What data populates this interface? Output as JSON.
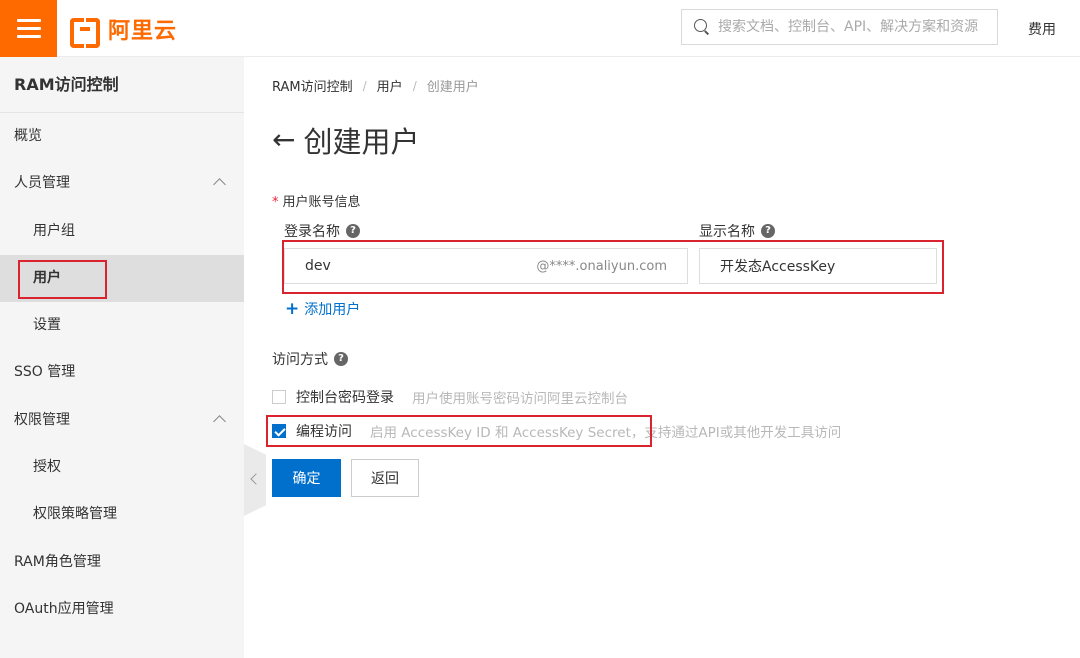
{
  "header": {
    "logo_text": "阿里云",
    "search_placeholder": "搜索文档、控制台、API、解决方案和资源",
    "fee_label": "费用",
    "brand_color": "#ff6a00"
  },
  "sidebar": {
    "title": "RAM访问控制",
    "items": [
      {
        "label": "概览"
      },
      {
        "label": "人员管理"
      },
      {
        "label": "用户组"
      },
      {
        "label": "用户"
      },
      {
        "label": "设置"
      },
      {
        "label": "SSO 管理"
      },
      {
        "label": "权限管理"
      },
      {
        "label": "授权"
      },
      {
        "label": "权限策略管理"
      },
      {
        "label": "RAM角色管理"
      },
      {
        "label": "OAuth应用管理"
      }
    ]
  },
  "breadcrumb": [
    "RAM访问控制",
    "用户",
    "创建用户"
  ],
  "page": {
    "title": "创建用户",
    "section_label": "用户账号信息",
    "login_name_label": "登录名称",
    "display_name_label": "显示名称",
    "login_name_value": "dev",
    "login_suffix": "@****.onaliyun.com",
    "display_name_value": "开发态AccessKey",
    "add_user_label": "添加用户",
    "access_label": "访问方式",
    "options": [
      {
        "name": "控制台密码登录",
        "desc": "用户使用账号密码访问阿里云控制台",
        "checked": false
      },
      {
        "name": "编程访问",
        "desc": "启用 AccessKey ID 和 AccessKey Secret，支持通过API或其他开发工具访问",
        "checked": true
      }
    ],
    "ok_label": "确定",
    "cancel_label": "返回",
    "accent_color": "#0070cc",
    "highlight_color": "#d9232e"
  }
}
